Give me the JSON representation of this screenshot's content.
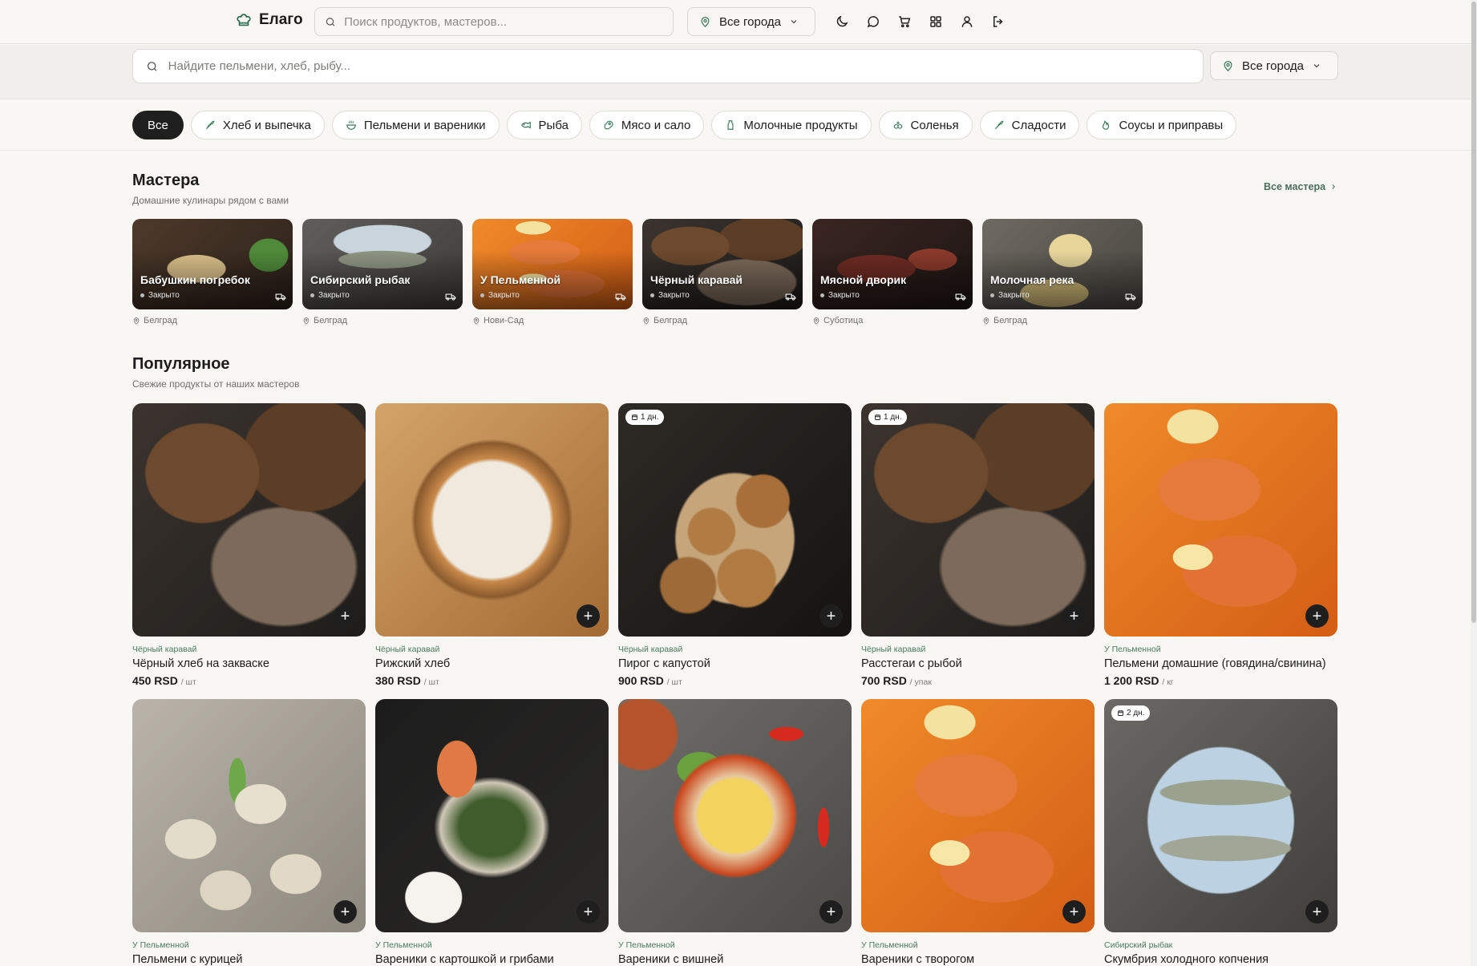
{
  "header": {
    "brand": "Елаго",
    "search_placeholder": "Поиск продуктов, мастеров...",
    "city": "Все города",
    "icons": [
      "moon-icon",
      "chat-icon",
      "cart-icon",
      "grid-icon",
      "user-icon",
      "logout-icon"
    ]
  },
  "search": {
    "placeholder": "Найдите пельмени, хлеб, рыбу...",
    "city": "Все города"
  },
  "categories": [
    {
      "label": "Все",
      "active": true
    },
    {
      "label": "Хлеб и выпечка",
      "icon": "wheat-icon"
    },
    {
      "label": "Пельмени и вареники",
      "icon": "dumpling-icon"
    },
    {
      "label": "Рыба",
      "icon": "fish-icon"
    },
    {
      "label": "Мясо и сало",
      "icon": "meat-icon"
    },
    {
      "label": "Молочные продукты",
      "icon": "milk-icon"
    },
    {
      "label": "Соленья",
      "icon": "pickles-icon"
    },
    {
      "label": "Сладости",
      "icon": "candy-icon"
    },
    {
      "label": "Соусы и приправы",
      "icon": "flame-icon"
    }
  ],
  "masters_section": {
    "title": "Мастера",
    "subtitle": "Домашние кулинары рядом с вами",
    "all_link": "Все мастера",
    "items": [
      {
        "name": "Бабушкин погребок",
        "status": "Закрыто",
        "city": "Белград",
        "image": "cellar"
      },
      {
        "name": "Сибирский рыбак",
        "status": "Закрыто",
        "city": "Белград",
        "image": "masterfish"
      },
      {
        "name": "У Пельменной",
        "status": "Закрыто",
        "city": "Нови-Сад",
        "image": "salmon"
      },
      {
        "name": "Чёрный каравай",
        "status": "Закрыто",
        "city": "Белград",
        "image": "bread-dark"
      },
      {
        "name": "Мясной дворик",
        "status": "Закрыто",
        "city": "Суботица",
        "image": "meat"
      },
      {
        "name": "Молочная река",
        "status": "Закрыто",
        "city": "Белград",
        "image": "cheese"
      }
    ]
  },
  "popular_section": {
    "title": "Популярное",
    "subtitle": "Свежие продукты от наших мастеров",
    "items": [
      {
        "master": "Чёрный каравай",
        "name": "Чёрный хлеб на закваске",
        "price": "450 RSD",
        "unit": "/ шт",
        "badge": "",
        "image": "bread-dark"
      },
      {
        "master": "Чёрный каравай",
        "name": "Рижский хлеб",
        "price": "380 RSD",
        "unit": "/ шт",
        "badge": "",
        "image": "bread-light"
      },
      {
        "master": "Чёрный каравай",
        "name": "Пирог с капустой",
        "price": "900 RSD",
        "unit": "/ шт",
        "badge": "1 дн.",
        "image": "cookies"
      },
      {
        "master": "Чёрный каравай",
        "name": "Расстегаи с рыбой",
        "price": "700 RSD",
        "unit": "/ упак",
        "badge": "1 дн.",
        "image": "bread-dark"
      },
      {
        "master": "У Пельменной",
        "name": "Пельмени домашние (говядина/свинина)",
        "price": "1 200 RSD",
        "unit": "/ кг",
        "badge": "",
        "image": "salmon"
      },
      {
        "master": "У Пельменной",
        "name": "Пельмени с курицей",
        "price": "",
        "unit": "",
        "badge": "",
        "image": "pelmeni"
      },
      {
        "master": "У Пельменной",
        "name": "Вареники с картошкой и грибами",
        "price": "",
        "unit": "",
        "badge": "",
        "image": "spinach"
      },
      {
        "master": "У Пельменной",
        "name": "Вареники с вишней",
        "price": "",
        "unit": "",
        "badge": "",
        "image": "noodles"
      },
      {
        "master": "У Пельменной",
        "name": "Вареники с творогом",
        "price": "",
        "unit": "",
        "badge": "",
        "image": "salmon"
      },
      {
        "master": "Сибирский рыбак",
        "name": "Скумбрия холодного копчения",
        "price": "",
        "unit": "",
        "badge": "2 дн.",
        "image": "fish"
      }
    ]
  },
  "colors": {
    "background": "#f8f7f4",
    "accent_green": "#4c7a5f",
    "chip_active": "#1f1f1f"
  }
}
